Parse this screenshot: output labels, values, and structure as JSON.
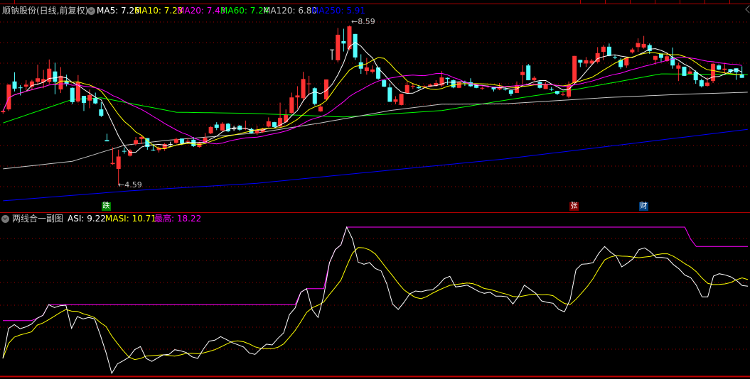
{
  "header": {
    "title": "顺钠股份(日线,前复权)",
    "ma": [
      {
        "label": "MA5: 7.26",
        "color": "#ffffff"
      },
      {
        "label": "MA10: 7.23",
        "color": "#ffff00"
      },
      {
        "label": "MA20: 7.43",
        "color": "#ff00ff"
      },
      {
        "label": "MA60: 7.24",
        "color": "#00ff00"
      },
      {
        "label": "MA120: 6.80",
        "color": "#c0c0c0"
      },
      {
        "label": "MA250: 5.91",
        "color": "#0000ff"
      }
    ]
  },
  "sub_header": {
    "title": "两线合一副图",
    "asi": {
      "label": "ASI: 9.22",
      "color": "#ffffff"
    },
    "masi": {
      "label": "MASI: 10.71",
      "color": "#ffff00"
    },
    "max": {
      "label": "最高: 18.22",
      "color": "#ff00ff"
    }
  },
  "markers": [
    {
      "text": "跌",
      "color": "#008000"
    },
    {
      "text": "张",
      "color": "#800000"
    },
    {
      "text": "财",
      "color": "#004080"
    }
  ],
  "price_labels": {
    "high": "8.59",
    "low": "4.59"
  },
  "colors": {
    "up": "#ff3333",
    "down": "#54ffff",
    "flat": "#ffffff",
    "grid": "#a00000"
  },
  "chart_data": [
    {
      "type": "candlestick",
      "title": "顺钠股份(日线,前复权)",
      "fields": [
        "open",
        "high",
        "low",
        "close"
      ],
      "ylim": [
        4.2,
        8.9
      ],
      "ohlc": [
        [
          6.42,
          6.48,
          6.38,
          6.45
        ],
        [
          6.49,
          7.12,
          6.45,
          7.11
        ],
        [
          7.19,
          7.42,
          6.94,
          7.01
        ],
        [
          7.04,
          7.1,
          6.84,
          7.03
        ],
        [
          7.06,
          7.22,
          6.97,
          7.11
        ],
        [
          7.06,
          7.23,
          6.97,
          7.19
        ],
        [
          7.18,
          7.61,
          7.1,
          7.27
        ],
        [
          7.17,
          7.48,
          7.02,
          7.25
        ],
        [
          7.18,
          7.74,
          7.13,
          7.51
        ],
        [
          7.44,
          7.66,
          6.87,
          7.18
        ],
        [
          6.99,
          7.55,
          6.9,
          7.33
        ],
        [
          7.21,
          7.36,
          7.07,
          7.13
        ],
        [
          7.03,
          7.04,
          6.62,
          6.67
        ],
        [
          6.69,
          7.35,
          6.66,
          7.17
        ],
        [
          6.83,
          6.83,
          6.45,
          6.65
        ],
        [
          6.71,
          6.99,
          6.52,
          6.85
        ],
        [
          6.77,
          6.91,
          6.62,
          6.64
        ],
        [
          6.49,
          6.67,
          6.3,
          6.33
        ],
        [
          5.72,
          5.88,
          5.69,
          5.69
        ],
        [
          5.12,
          5.54,
          5.1,
          5.15
        ],
        [
          5.0,
          5.48,
          4.59,
          5.31
        ],
        [
          5.45,
          5.54,
          5.38,
          5.44
        ],
        [
          5.33,
          5.5,
          5.31,
          5.46
        ],
        [
          5.62,
          5.8,
          5.59,
          5.72
        ],
        [
          5.75,
          5.83,
          5.62,
          5.8
        ],
        [
          5.77,
          5.77,
          5.48,
          5.55
        ],
        [
          5.48,
          5.62,
          5.45,
          5.47
        ],
        [
          5.47,
          5.56,
          5.41,
          5.53
        ],
        [
          5.5,
          5.65,
          5.45,
          5.62
        ],
        [
          5.62,
          5.68,
          5.58,
          5.62
        ],
        [
          5.65,
          5.78,
          5.63,
          5.75
        ],
        [
          5.76,
          5.76,
          5.6,
          5.64
        ],
        [
          5.68,
          5.78,
          5.62,
          5.7
        ],
        [
          5.73,
          5.8,
          5.55,
          5.57
        ],
        [
          5.55,
          5.68,
          5.53,
          5.65
        ],
        [
          5.66,
          5.9,
          5.63,
          5.78
        ],
        [
          5.89,
          6.07,
          5.87,
          6.05
        ],
        [
          6.11,
          6.17,
          5.97,
          6.03
        ],
        [
          5.96,
          6.17,
          5.95,
          6.13
        ],
        [
          6.13,
          6.15,
          5.92,
          5.94
        ],
        [
          6.01,
          6.08,
          5.95,
          6.01
        ],
        [
          6.08,
          6.1,
          5.95,
          5.98
        ],
        [
          6.0,
          6.21,
          5.97,
          6.02
        ],
        [
          6.0,
          6.03,
          5.88,
          5.9
        ],
        [
          5.89,
          6.08,
          5.85,
          5.96
        ],
        [
          5.92,
          6.03,
          5.9,
          6.01
        ],
        [
          6.06,
          6.29,
          6.04,
          6.19
        ],
        [
          6.17,
          6.18,
          6.03,
          6.05
        ],
        [
          6.06,
          6.66,
          6.04,
          6.28
        ],
        [
          6.17,
          6.49,
          6.15,
          6.35
        ],
        [
          6.4,
          6.91,
          6.38,
          6.79
        ],
        [
          6.79,
          7.07,
          6.5,
          6.84
        ],
        [
          6.77,
          7.43,
          6.71,
          7.25
        ],
        [
          7.12,
          7.33,
          6.85,
          7.14
        ],
        [
          7.02,
          7.04,
          6.59,
          6.63
        ],
        [
          6.44,
          6.62,
          6.43,
          6.56
        ],
        [
          6.74,
          7.24,
          6.72,
          7.24
        ],
        [
          7.99,
          7.99,
          7.73,
          7.99
        ],
        [
          7.72,
          8.53,
          7.67,
          8.36
        ],
        [
          8.2,
          8.51,
          7.94,
          8.14
        ],
        [
          8.0,
          8.59,
          7.97,
          8.57
        ],
        [
          8.38,
          8.38,
          7.73,
          7.79
        ],
        [
          7.67,
          7.87,
          7.38,
          7.51
        ],
        [
          7.45,
          7.78,
          7.36,
          7.54
        ],
        [
          7.43,
          7.59,
          7.39,
          7.49
        ],
        [
          7.54,
          7.54,
          7.23,
          7.26
        ],
        [
          7.22,
          7.24,
          7.05,
          7.06
        ],
        [
          7.04,
          7.14,
          6.68,
          6.68
        ],
        [
          6.68,
          6.82,
          6.62,
          6.74
        ],
        [
          6.6,
          6.88,
          6.59,
          6.88
        ],
        [
          6.9,
          7.19,
          6.89,
          7.1
        ],
        [
          7.07,
          7.15,
          7.0,
          7.08
        ],
        [
          7.05,
          7.1,
          7.0,
          7.02
        ],
        [
          7.05,
          7.09,
          7.02,
          7.07
        ],
        [
          7.06,
          7.13,
          7.05,
          7.11
        ],
        [
          7.08,
          7.22,
          7.06,
          7.15
        ],
        [
          7.09,
          7.45,
          7.05,
          7.29
        ],
        [
          7.28,
          7.29,
          7.1,
          7.25
        ],
        [
          7.22,
          7.24,
          7.02,
          7.04
        ],
        [
          7.03,
          7.18,
          7.02,
          7.17
        ],
        [
          7.17,
          7.21,
          7.08,
          7.16
        ],
        [
          7.17,
          7.27,
          7.05,
          7.07
        ],
        [
          7.1,
          7.11,
          7.02,
          7.03
        ],
        [
          7.02,
          7.06,
          6.98,
          7.03
        ],
        [
          7.06,
          7.1,
          7.03,
          7.07
        ],
        [
          7.06,
          7.06,
          6.94,
          6.99
        ],
        [
          6.99,
          7.15,
          6.97,
          7.05
        ],
        [
          7.0,
          7.04,
          6.96,
          6.99
        ],
        [
          6.97,
          6.97,
          6.83,
          6.88
        ],
        [
          6.9,
          7.19,
          6.9,
          7.1
        ],
        [
          7.35,
          7.6,
          7.13,
          7.43
        ],
        [
          7.59,
          7.63,
          7.22,
          7.22
        ],
        [
          7.22,
          7.32,
          7.2,
          7.28
        ],
        [
          7.18,
          7.21,
          7.01,
          7.03
        ],
        [
          7.0,
          7.18,
          7.0,
          7.11
        ],
        [
          7.0,
          7.05,
          6.95,
          6.99
        ],
        [
          6.95,
          6.95,
          6.85,
          6.88
        ],
        [
          6.86,
          6.92,
          6.83,
          6.87
        ],
        [
          6.81,
          7.19,
          6.77,
          7.11
        ],
        [
          7.15,
          7.83,
          7.14,
          7.83
        ],
        [
          7.73,
          7.73,
          7.55,
          7.66
        ],
        [
          7.64,
          7.8,
          7.55,
          7.72
        ],
        [
          7.64,
          7.75,
          7.62,
          7.71
        ],
        [
          7.68,
          8.05,
          7.64,
          7.9
        ],
        [
          7.93,
          8.1,
          7.72,
          8.06
        ],
        [
          8.06,
          8.14,
          7.82,
          7.83
        ],
        [
          7.8,
          7.85,
          7.75,
          7.79
        ],
        [
          7.73,
          7.77,
          7.5,
          7.55
        ],
        [
          7.59,
          7.78,
          7.53,
          7.78
        ],
        [
          7.92,
          8.03,
          7.89,
          7.99
        ],
        [
          8.05,
          8.27,
          7.93,
          8.15
        ],
        [
          8.04,
          8.33,
          8.01,
          8.13
        ],
        [
          8.1,
          8.14,
          7.88,
          7.95
        ],
        [
          7.73,
          7.83,
          7.61,
          7.83
        ],
        [
          7.89,
          7.89,
          7.68,
          7.78
        ],
        [
          7.7,
          7.91,
          7.68,
          7.82
        ],
        [
          7.79,
          8.04,
          7.51,
          7.59
        ],
        [
          7.51,
          7.66,
          7.2,
          7.59
        ],
        [
          7.56,
          7.56,
          7.33,
          7.33
        ],
        [
          7.38,
          7.56,
          7.38,
          7.44
        ],
        [
          7.43,
          7.47,
          7.13,
          7.22
        ],
        [
          7.22,
          7.26,
          7.04,
          7.07
        ],
        [
          7.08,
          7.3,
          7.06,
          7.16
        ],
        [
          7.2,
          7.66,
          7.15,
          7.63
        ],
        [
          7.59,
          7.62,
          7.47,
          7.49
        ],
        [
          7.48,
          7.66,
          7.39,
          7.51
        ],
        [
          7.5,
          7.5,
          7.4,
          7.42
        ],
        [
          7.52,
          7.52,
          7.23,
          7.42
        ],
        [
          7.37,
          7.57,
          7.28,
          7.28
        ]
      ],
      "computed_ma": [
        {
          "name": "MA5",
          "period": 5,
          "color": "#ffffff"
        },
        {
          "name": "MA10",
          "period": 10,
          "color": "#ffff00"
        },
        {
          "name": "MA20",
          "period": 20,
          "color": "#ff00ff"
        }
      ],
      "sampled_ma": [
        {
          "name": "MA60",
          "color": "#00ff00",
          "points": [
            [
              0,
              6.15
            ],
            [
              12,
              6.74
            ],
            [
              17,
              6.78
            ],
            [
              30,
              6.42
            ],
            [
              43,
              6.39
            ],
            [
              59,
              6.3
            ],
            [
              76,
              6.46
            ],
            [
              87,
              6.72
            ],
            [
              100,
              7.01
            ],
            [
              114,
              7.38
            ],
            [
              129,
              7.36
            ]
          ]
        },
        {
          "name": "MA120",
          "color": "#c8c8c8",
          "points": [
            [
              0,
              5.0
            ],
            [
              12,
              5.19
            ],
            [
              21,
              5.59
            ],
            [
              28,
              5.71
            ],
            [
              44,
              5.9
            ],
            [
              55,
              6.15
            ],
            [
              67,
              6.46
            ],
            [
              76,
              6.62
            ],
            [
              87,
              6.63
            ],
            [
              105,
              6.79
            ],
            [
              118,
              6.87
            ],
            [
              129,
              6.92
            ]
          ]
        },
        {
          "name": "MA250",
          "color": "#0000ff",
          "points": [
            [
              0,
              4.2
            ],
            [
              22,
              4.45
            ],
            [
              44,
              4.64
            ],
            [
              87,
              5.25
            ],
            [
              129,
              5.99
            ]
          ]
        }
      ]
    },
    {
      "type": "line",
      "title": "两线合一副图",
      "ylim": [
        -5,
        19.5
      ],
      "series": [
        {
          "name": "ASI",
          "color": "#ffffff",
          "values": [
            -1.7,
            2.84,
            3.42,
            2.78,
            3.06,
            3.48,
            4.39,
            4.82,
            6.43,
            6.0,
            6.28,
            6.35,
            2.84,
            4.63,
            4.28,
            4.49,
            4.28,
            1.87,
            -0.81,
            -3.96,
            -2.53,
            -2.06,
            -1.52,
            -0.38,
            0.09,
            -1.7,
            -2.16,
            -1.63,
            -1.17,
            -1.09,
            -0.38,
            -0.55,
            -0.81,
            -1.46,
            -1.7,
            -0.27,
            0.91,
            1.06,
            1.59,
            1.16,
            0.69,
            0.37,
            0.02,
            -0.88,
            -1.09,
            -0.27,
            0.45,
            0.34,
            1.34,
            2.16,
            4.92,
            5.92,
            8.32,
            8.85,
            5.63,
            4.49,
            7.78,
            12.8,
            14.76,
            15.48,
            18.17,
            16.37,
            12.87,
            12.55,
            12.8,
            11.9,
            11.54,
            9.57,
            6.53,
            5.71,
            6.78,
            8.07,
            8.5,
            8.39,
            8.61,
            8.68,
            9.39,
            10.36,
            10.72,
            9.11,
            9.22,
            9.39,
            8.93,
            8.43,
            8.15,
            8.32,
            7.72,
            7.72,
            7.61,
            6.53,
            7.72,
            9.39,
            8.75,
            8.15,
            7.0,
            6.78,
            6.64,
            5.71,
            5.35,
            7.24,
            11.72,
            12.55,
            12.61,
            12.8,
            14.22,
            15.23,
            14.41,
            13.8,
            12.15,
            12.72,
            13.41,
            14.76,
            15.02,
            14.41,
            13.58,
            13.58,
            13.44,
            12.51,
            11.83,
            10.9,
            10.54,
            9.39,
            7.61,
            7.61,
            10.76,
            11.11,
            10.94,
            10.65,
            10.11,
            9.33,
            9.22
          ]
        },
        {
          "name": "MASI",
          "color": "#ffff00",
          "period": 6
        },
        {
          "name": "最高",
          "color": "#ff00ff",
          "window": 60,
          "initial": 4.02
        }
      ]
    }
  ]
}
